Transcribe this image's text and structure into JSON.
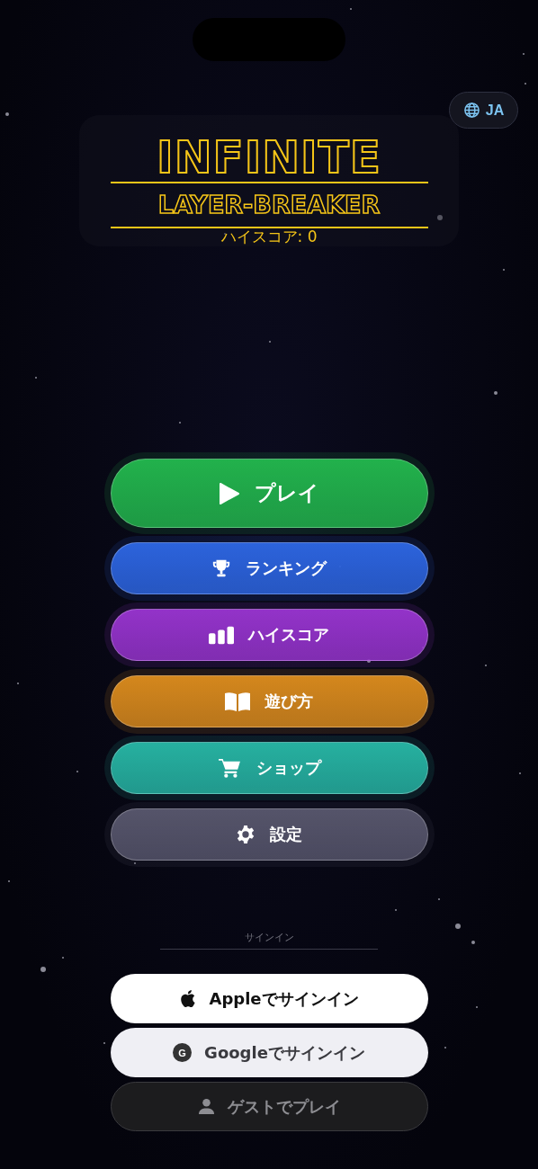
{
  "language_button": {
    "label": "JA"
  },
  "title": {
    "line_1": "INFINITE",
    "line_2": "LAYER-BREAKER",
    "high_score": "ハイスコア: 0"
  },
  "menu": [
    {
      "kind": "play",
      "label": "プレイ",
      "color": "#22b14c"
    },
    {
      "kind": "trophy",
      "label": "ランキング",
      "color": "#2c63dc"
    },
    {
      "kind": "bars",
      "label": "ハイスコア",
      "color": "#9333c9"
    },
    {
      "kind": "book",
      "label": "遊び方",
      "color": "#d4871d"
    },
    {
      "kind": "cart",
      "label": "ショップ",
      "color": "#26b0a0"
    },
    {
      "kind": "gear",
      "label": "設定",
      "color": "#55546a"
    }
  ],
  "sign_in": {
    "heading": "サインイン",
    "buttons": [
      {
        "kind": "apple",
        "label": "Appleでサインイン"
      },
      {
        "kind": "google",
        "label": "Googleでサインイン",
        "icon_letter": "G"
      },
      {
        "kind": "guest",
        "label": "ゲストでプレイ"
      }
    ]
  }
}
